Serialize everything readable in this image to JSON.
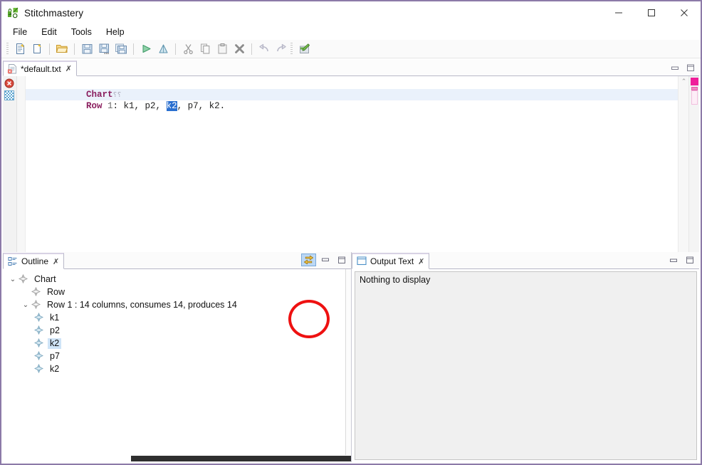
{
  "window": {
    "title": "Stitchmastery",
    "app_icon": "stitchmastery-logo-icon",
    "controls": {
      "minimize": "—",
      "maximize": "☐",
      "close": "✕"
    }
  },
  "menubar": {
    "items": [
      {
        "label": "File",
        "name": "menu-file"
      },
      {
        "label": "Edit",
        "name": "menu-edit"
      },
      {
        "label": "Tools",
        "name": "menu-tools"
      },
      {
        "label": "Help",
        "name": "menu-help"
      }
    ]
  },
  "toolbar": {
    "buttons": [
      {
        "name": "new-file-icon",
        "tooltip": "New",
        "enabled": true
      },
      {
        "name": "new-from-template-icon",
        "tooltip": "New from template",
        "enabled": true
      },
      {
        "sep": true
      },
      {
        "name": "open-folder-icon",
        "tooltip": "Open",
        "enabled": true
      },
      {
        "sep": true
      },
      {
        "name": "save-icon",
        "tooltip": "Save",
        "enabled": true
      },
      {
        "name": "save-as-icon",
        "tooltip": "Save As",
        "enabled": true
      },
      {
        "name": "save-all-icon",
        "tooltip": "Save All",
        "enabled": true
      },
      {
        "sep": true
      },
      {
        "name": "run-icon",
        "tooltip": "Run",
        "enabled": true
      },
      {
        "name": "chart-up-icon",
        "tooltip": "Generate chart",
        "enabled": true
      },
      {
        "sep": true
      },
      {
        "name": "cut-icon",
        "tooltip": "Cut",
        "enabled": false
      },
      {
        "name": "copy-icon",
        "tooltip": "Copy",
        "enabled": false
      },
      {
        "name": "paste-icon",
        "tooltip": "Paste",
        "enabled": false
      },
      {
        "name": "delete-icon",
        "tooltip": "Delete",
        "enabled": false
      },
      {
        "sep": true
      },
      {
        "name": "undo-icon",
        "tooltip": "Undo",
        "enabled": false
      },
      {
        "name": "redo-icon",
        "tooltip": "Redo",
        "enabled": false
      },
      {
        "grip": true
      },
      {
        "name": "edit-chart-icon",
        "tooltip": "Edit chart",
        "enabled": true
      }
    ]
  },
  "editor": {
    "tab": {
      "label": "*default.txt",
      "icon": "text-file-icon",
      "close": "✗",
      "dirty": true
    },
    "panel_controls": {
      "minimize": "minimize-icon",
      "maximize": "maximize-icon"
    },
    "gutter": {
      "error_marker": "error-icon",
      "change_marker": "checkered-marker-icon"
    },
    "lines": [
      {
        "current": false,
        "tokens": [
          {
            "text": "Chart",
            "kind": "keyword"
          },
          {
            "text": "⸮⸮",
            "kind": "marker"
          }
        ]
      },
      {
        "current": true,
        "tokens": [
          {
            "text": "Row",
            "kind": "keyword"
          },
          {
            "text": " 1",
            "kind": "number"
          },
          {
            "text": ": k1, p2, ",
            "kind": "plain"
          },
          {
            "text": "k2",
            "kind": "selected"
          },
          {
            "text": ", p7, k2.",
            "kind": "plain"
          }
        ]
      }
    ],
    "plain_text": "Chart\nRow 1: k1, p2, k2, p7, k2.",
    "scroll": {
      "up": "⌃",
      "down": "⌄",
      "left": "‹",
      "right": "›"
    },
    "overview_ruler": {
      "marker_color": "#ef1e9a",
      "outline_color": "#f09ad0"
    }
  },
  "outline_panel": {
    "tab": {
      "label": "Outline",
      "icon": "outline-icon",
      "close": "✗"
    },
    "controls": {
      "link_with_editor": "link-with-editor-icon",
      "minimize": "minimize-icon",
      "maximize": "maximize-icon",
      "link_active": true
    },
    "tree": [
      {
        "label": "Chart",
        "indent": 0,
        "twisty": "⌄",
        "diamond": "gray",
        "selected": false
      },
      {
        "label": "Row",
        "indent": 1,
        "twisty": "",
        "diamond": "gray",
        "selected": false
      },
      {
        "label": "Row 1 : 14 columns, consumes 14, produces 14",
        "indent": 1,
        "twisty": "⌄",
        "diamond": "gray",
        "selected": false
      },
      {
        "label": "k1",
        "indent": 2,
        "twisty": "",
        "diamond": "blue",
        "selected": false
      },
      {
        "label": "p2",
        "indent": 2,
        "twisty": "",
        "diamond": "blue",
        "selected": false
      },
      {
        "label": "k2",
        "indent": 2,
        "twisty": "",
        "diamond": "blue",
        "selected": true
      },
      {
        "label": "p7",
        "indent": 2,
        "twisty": "",
        "diamond": "blue",
        "selected": false
      },
      {
        "label": "k2",
        "indent": 2,
        "twisty": "",
        "diamond": "blue",
        "selected": false
      }
    ]
  },
  "output_panel": {
    "tab": {
      "label": "Output Text",
      "icon": "output-window-icon",
      "close": "✗"
    },
    "controls": {
      "minimize": "minimize-icon",
      "maximize": "maximize-icon"
    },
    "content": "Nothing to display"
  },
  "annotation": {
    "type": "red-circle-highlight",
    "target": "link-with-editor-icon",
    "color": "#ee1111"
  },
  "colors": {
    "window_border": "#8c7aa8",
    "keyword": "#8b2060",
    "selection": "#2a6fd0",
    "tree_selection": "#cfe4f7",
    "toggle_active": "#bcd8f5",
    "annotation": "#ee1111"
  }
}
